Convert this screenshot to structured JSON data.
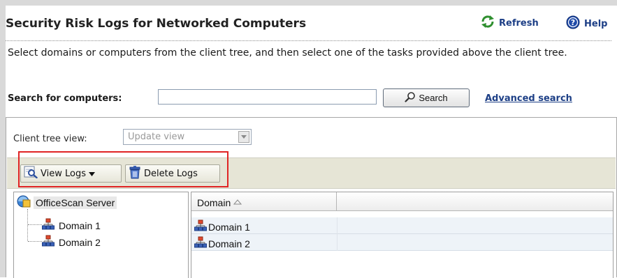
{
  "header": {
    "title": "Security Risk Logs for Networked Computers",
    "refresh_label": "Refresh",
    "help_label": "Help"
  },
  "intro_text": "Select domains or computers from the client tree, and then select one of the tasks provided above the client tree.",
  "search": {
    "label": "Search for computers:",
    "value": "",
    "placeholder": "",
    "button_label": "Search",
    "advanced_link": "Advanced search"
  },
  "client_tree_view": {
    "label": "Client tree view:",
    "selected": "Update view"
  },
  "toolbar": {
    "view_logs_label": "View Logs",
    "delete_logs_label": "Delete Logs"
  },
  "tree": {
    "root": "OfficeScan Server",
    "nodes": [
      "Domain 1",
      "Domain 2"
    ]
  },
  "grid": {
    "columns": [
      "Domain"
    ],
    "rows": [
      "Domain 1",
      "Domain 2"
    ]
  },
  "colors": {
    "link_blue": "#1d3f86",
    "toolbar_bg": "#e6e5d6",
    "highlight_red": "#e02424",
    "row_bg": "#eef3f8"
  },
  "icons": [
    "refresh-icon",
    "help-icon",
    "search-icon",
    "view-logs-icon",
    "dropdown-arrow-icon",
    "trash-icon",
    "server-icon",
    "domain-icon",
    "sort-ascending-icon"
  ]
}
